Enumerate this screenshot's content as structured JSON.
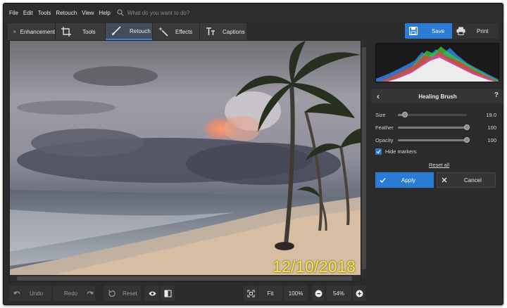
{
  "menu": {
    "items": [
      "File",
      "Edit",
      "Tools",
      "Retouch",
      "View",
      "Help"
    ],
    "search_placeholder": "What do you want to do?"
  },
  "toolbar": {
    "tabs": [
      {
        "label": "Enhancement",
        "icon": "sliders-icon"
      },
      {
        "label": "Tools",
        "icon": "crop-icon"
      },
      {
        "label": "Retouch",
        "icon": "brush-icon",
        "active": true
      },
      {
        "label": "Effects",
        "icon": "magic-wand-icon"
      },
      {
        "label": "Captions",
        "icon": "text-icon"
      }
    ],
    "save_label": "Save",
    "print_label": "Print"
  },
  "canvas": {
    "date_stamp": "12/10/2018"
  },
  "bottom": {
    "undo_label": "Undo",
    "redo_label": "Redo",
    "reset_label": "Reset",
    "fit_label": "Fit",
    "zoom_100": "100%",
    "zoom_current": "54%"
  },
  "panel": {
    "title": "Healing Brush",
    "help": "?",
    "size_label": "Size",
    "size_value": "19.0",
    "size_fraction": 0.1,
    "feather_label": "Feather",
    "feather_value": "100",
    "feather_fraction": 1.0,
    "opacity_label": "Opacity",
    "opacity_value": "100",
    "opacity_fraction": 1.0,
    "hide_markers_label": "Hide markers",
    "hide_markers_checked": true,
    "reset_all_label": "Reset all",
    "apply_label": "Apply",
    "cancel_label": "Cancel"
  },
  "colors": {
    "accent": "#2a7bd3",
    "date_stamp": "#f7e83a",
    "background": "#2b2b2b"
  }
}
